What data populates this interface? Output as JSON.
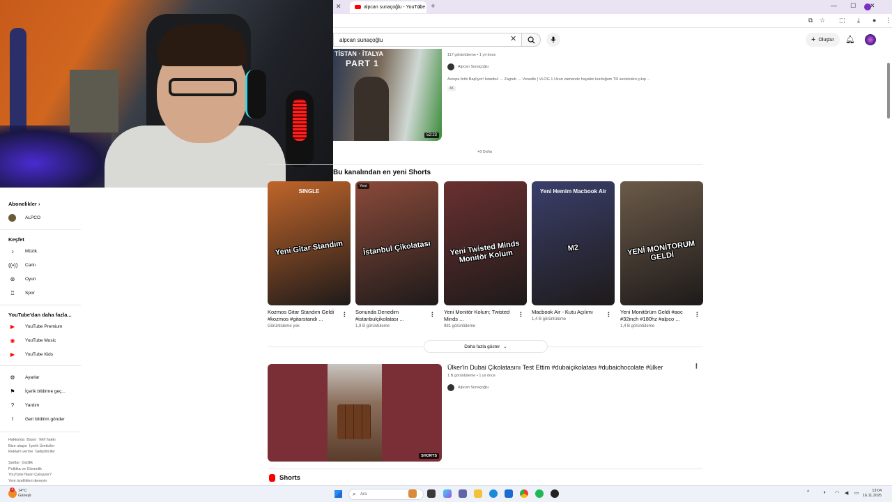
{
  "browser": {
    "tab_title": "alpcan sunaçoğlu - YouTube",
    "new_tab": "+",
    "close": "✕"
  },
  "search": {
    "query": "alpcan sunaçoğlu"
  },
  "masthead": {
    "create_label": "Oluştur"
  },
  "sidebar": {
    "subs_title": "Abonelikler",
    "subs_items": [
      {
        "label": "ALPCO"
      }
    ],
    "explore_title": "Keşfet",
    "explore_items": [
      {
        "label": "Müzik",
        "icon": "music-note-icon"
      },
      {
        "label": "Canlı",
        "icon": "live-icon"
      },
      {
        "label": "Oyun",
        "icon": "gamepad-icon"
      },
      {
        "label": "Spor",
        "icon": "trophy-icon"
      }
    ],
    "more_title": "YouTube'dan daha fazla...",
    "more_items": [
      {
        "label": "YouTube Premium"
      },
      {
        "label": "YouTube Music"
      },
      {
        "label": "YouTube Kids"
      }
    ],
    "settings_items": [
      {
        "label": "Ayarlar"
      },
      {
        "label": "İçerik bildirme geç..."
      },
      {
        "label": "Yardım"
      },
      {
        "label": "Geri bildirim gönder"
      }
    ],
    "footer1": "Hakkında  Basın  Telif hakkı\nBize ulaşın  İçerik Üreticiler\nReklam verme  Geliştiriciler",
    "footer2": "Şartlar  Gizlilik\nPolitika ve Güvenlik\nYouTube Nasıl Çalışıyor?\nYeni özellikleri deneyin"
  },
  "top_video": {
    "thumb_text": "TİSTAN · İTALYA",
    "thumb_part": "PART 1",
    "duration": "52:23",
    "meta": "117 görüntüleme • 1 yıl önce",
    "channel": "Alpcan Sunaçoğlu",
    "description": "Avrupa fethi Başlıyor! İstanbul → Zagreb → Venedik | VLOG 1 Uzun zamandır hayalini kurduğum TR serisinden çıkıp ...",
    "badge": "4K",
    "more_link": "+8 Daha"
  },
  "shorts_section": {
    "heading": "Bu kanalından en yeni Shorts",
    "items": [
      {
        "title": "Kozmos Gitar Standım Geldi #kozmos #gitarstandı ...",
        "views": "Görüntüleme yok",
        "overlay": "Yeni Gitar Standım",
        "top": "SINGLE",
        "bg": "#c0652a",
        "new": ""
      },
      {
        "title": "Sonunda Denedim #istanbulçikolatası ...",
        "views": "1,9 B görüntüleme",
        "overlay": "İstanbul Çikolatası",
        "top": "",
        "bg": "#8a4a3a",
        "new": "Yeni"
      },
      {
        "title": "Yeni Monitör Kolum; Twisted Minds ...",
        "views": "981 görüntüleme",
        "overlay": "Yeni Twisted Minds Monitör Kolum",
        "top": "",
        "bg": "#6a3030",
        "new": ""
      },
      {
        "title": "Macbook Air - Kutu Açılımı",
        "views": "1,4 B görüntüleme",
        "overlay": "M2",
        "top": "Yeni Hemim Macbook Air",
        "bg": "#3a3f6a",
        "new": ""
      },
      {
        "title": "Yeni Monitörüm Geldi #aoc #32inch #180hz #alpco ...",
        "views": "1,4 B görüntüleme",
        "overlay": "YENİ MONİTORUM GELDİ",
        "top": "",
        "bg": "#6b5a48",
        "new": ""
      }
    ],
    "show_more": "Daha fazla göster"
  },
  "bottom_video": {
    "title": "Ülker'in Dubai Çikolatasını Test Ettim #dubaiçikolatası #dubaichocolate #ülker",
    "meta": "1 B görüntüleme • 1 yıl önce",
    "channel": "Alpcan Sunaçoğlu",
    "tag": "SHORTS"
  },
  "shorts_footer": {
    "label": "Shorts"
  },
  "taskbar": {
    "weather_temp": "14°C",
    "weather_desc": "Güneşli",
    "weather_badge": "1",
    "search_placeholder": "Ara",
    "time": "13:04",
    "date": "16.11.2025"
  },
  "colors": {
    "youtube_red": "#ff0000",
    "text_primary": "#0f0f0f",
    "text_secondary": "#606060"
  }
}
